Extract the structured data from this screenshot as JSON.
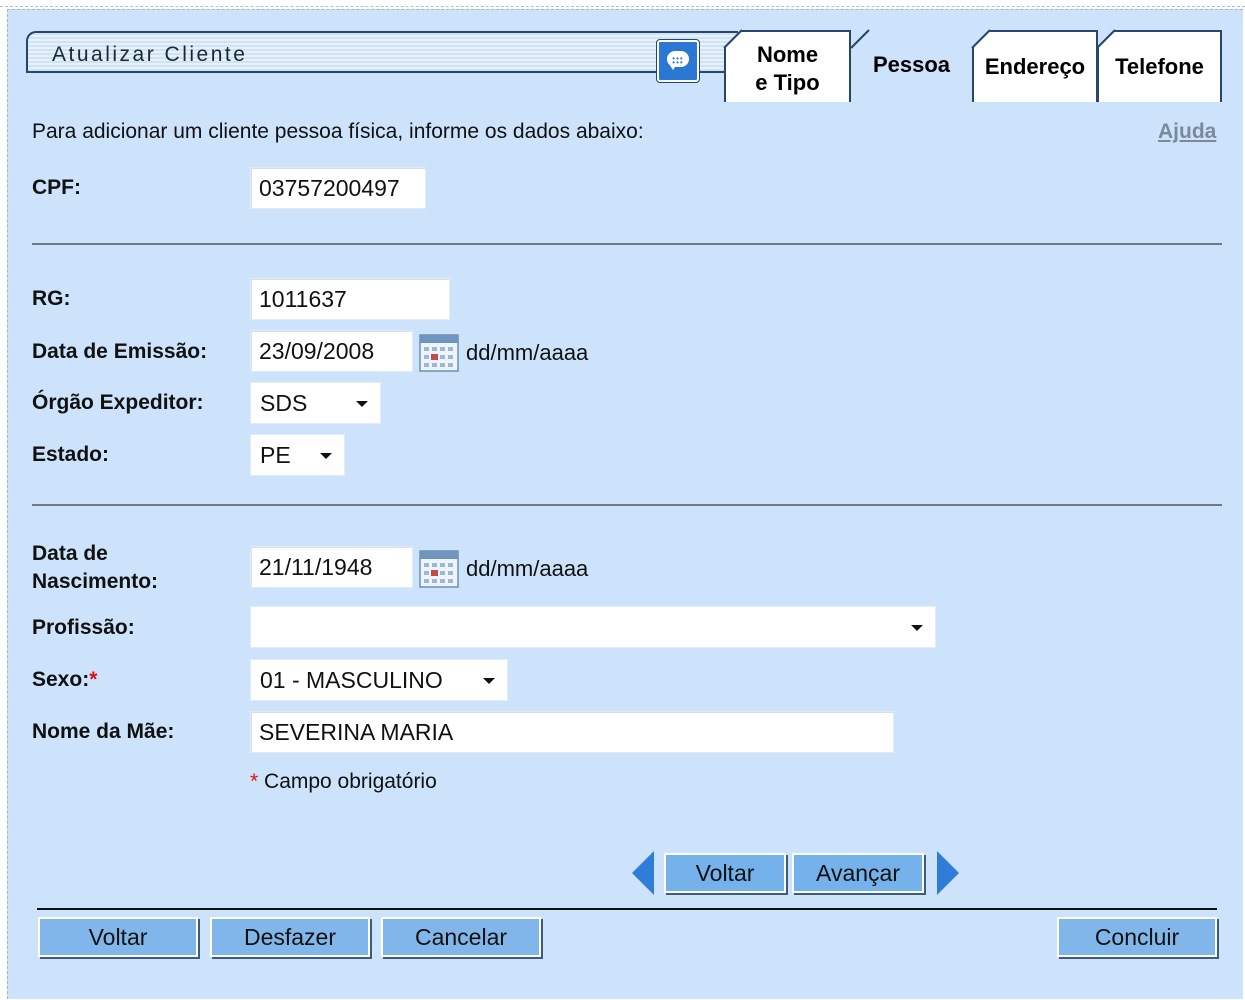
{
  "title": "Atualizar Cliente",
  "tabs": [
    {
      "line1": "Nome",
      "line2": "e Tipo"
    },
    {
      "label": "Pessoa"
    },
    {
      "label": "Endereço"
    },
    {
      "label": "Telefone"
    }
  ],
  "instruction": "Para adicionar um cliente pessoa física, informe os dados abaixo:",
  "help_label": "Ajuda",
  "fields": {
    "cpf": {
      "label": "CPF:",
      "value": "03757200497"
    },
    "rg": {
      "label": "RG:",
      "value": "1011637"
    },
    "data_emissao": {
      "label": "Data de Emissão:",
      "value": "23/09/2008",
      "format": "dd/mm/aaaa"
    },
    "orgao_expeditor": {
      "label": "Órgão Expeditor:",
      "value": "SDS"
    },
    "estado": {
      "label": "Estado:",
      "value": "PE"
    },
    "data_nascimento": {
      "label_line1": "Data de",
      "label_line2": "Nascimento:",
      "value": "21/11/1948",
      "format": "dd/mm/aaaa"
    },
    "profissao": {
      "label": "Profissão:",
      "value": ""
    },
    "sexo": {
      "label": "Sexo:",
      "required_mark": "*",
      "value": "01 - MASCULINO"
    },
    "nome_mae": {
      "label": "Nome da Mãe:",
      "value": "SEVERINA MARIA"
    }
  },
  "required_note": {
    "mark": "*",
    "text": " Campo obrigatório"
  },
  "wizard_nav": {
    "back_label": "Voltar",
    "next_label": "Avançar"
  },
  "footer_buttons": {
    "back": "Voltar",
    "undo": "Desfazer",
    "cancel": "Cancelar",
    "finish": "Concluir"
  },
  "colors": {
    "panel_bg": "#cde3fb",
    "button_bg": "#81b6ea",
    "arrow": "#2f7dd8",
    "border_dark": "#27466b"
  },
  "icons": {
    "chat": "chat-bubble-icon",
    "calendar": "calendar-icon",
    "dropdown": "chevron-down-icon"
  }
}
